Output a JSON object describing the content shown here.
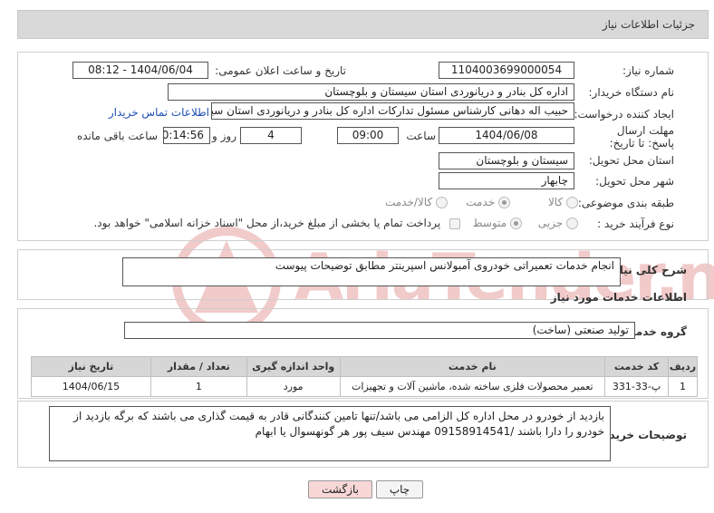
{
  "header": {
    "title": "جزئیات اطلاعات نیاز"
  },
  "fields": {
    "need_number": {
      "label": "شماره نیاز:",
      "value": "1104003699000054"
    },
    "announce_datetime": {
      "label": "تاریخ و ساعت اعلان عمومی:",
      "value": "1404/06/04 - 08:12"
    },
    "buyer_org": {
      "label": "نام دستگاه خریدار:",
      "value": "اداره کل بنادر و دریانوردی استان سیستان و بلوچستان"
    },
    "requester": {
      "label": "ایجاد کننده درخواست:",
      "value": "حبیب اله دهانی کارشناس مسئول تدارکات اداره کل بنادر و دریانوردی استان سیستان"
    },
    "contact_link": "اطلاعات تماس خریدار",
    "deadline": {
      "label": "مهلت ارسال پاسخ: تا تاریخ:",
      "date": "1404/06/08",
      "time_label": "ساعت",
      "time": "09:00",
      "days": "4",
      "days_label": "روز و",
      "remaining": "00:14:56",
      "remaining_label": "ساعت باقی مانده"
    },
    "province": {
      "label": "استان محل تحویل:",
      "value": "سیستان و بلوچستان"
    },
    "city": {
      "label": "شهر محل تحویل:",
      "value": "چابهار"
    },
    "category": {
      "label": "طبقه بندی موضوعی:",
      "options": [
        "کالا",
        "خدمت",
        "کالا/خدمت"
      ],
      "selected": "خدمت"
    },
    "process_type": {
      "label": "نوع فرآیند خرید :",
      "options": [
        "جزیی",
        "متوسط"
      ],
      "selected": "متوسط",
      "payment_note": "پرداخت تمام یا بخشی از مبلغ خرید،از محل \"اسناد خزانه اسلامی\" خواهد بود."
    }
  },
  "general_description": {
    "label": "شرح کلی نیاز:",
    "value": "انجام خدمات تعمیراتی خودروی آمبولانس اسپرینتر مطابق توضیحات پیوست"
  },
  "services_section": {
    "title": "اطلاعات خدمات مورد نیاز",
    "group_label": "گروه خدمت:",
    "group_value": "تولید صنعتی (ساخت)",
    "table": {
      "headers": [
        "ردیف",
        "کد خدمت",
        "نام خدمت",
        "واحد اندازه گیری",
        "تعداد / مقدار",
        "تاریخ نیاز"
      ],
      "rows": [
        [
          "1",
          "پ-33-331",
          "تعمیر محصولات فلزی ساخته شده، ماشین آلات و تجهیزات",
          "مورد",
          "1",
          "1404/06/15"
        ]
      ]
    }
  },
  "buyer_notes": {
    "label": "توضیحات خریدار:",
    "value": "بازدید از خودرو در محل اداره کل الزامی می باشد/تنها تامین کنندگانی قادر به قیمت گذاری می باشند که برگه بازدید از خودرو را دارا باشند /09158914541 مهندس سیف پور هر گونهسوال یا ابهام"
  },
  "buttons": {
    "print": "چاپ",
    "back": "بازگشت"
  },
  "watermark": "AriaTender.neT",
  "colors": {
    "back_button_bg": "#f8d7d7",
    "link": "#1f4fb5",
    "watermark": "#e3a3a3"
  }
}
